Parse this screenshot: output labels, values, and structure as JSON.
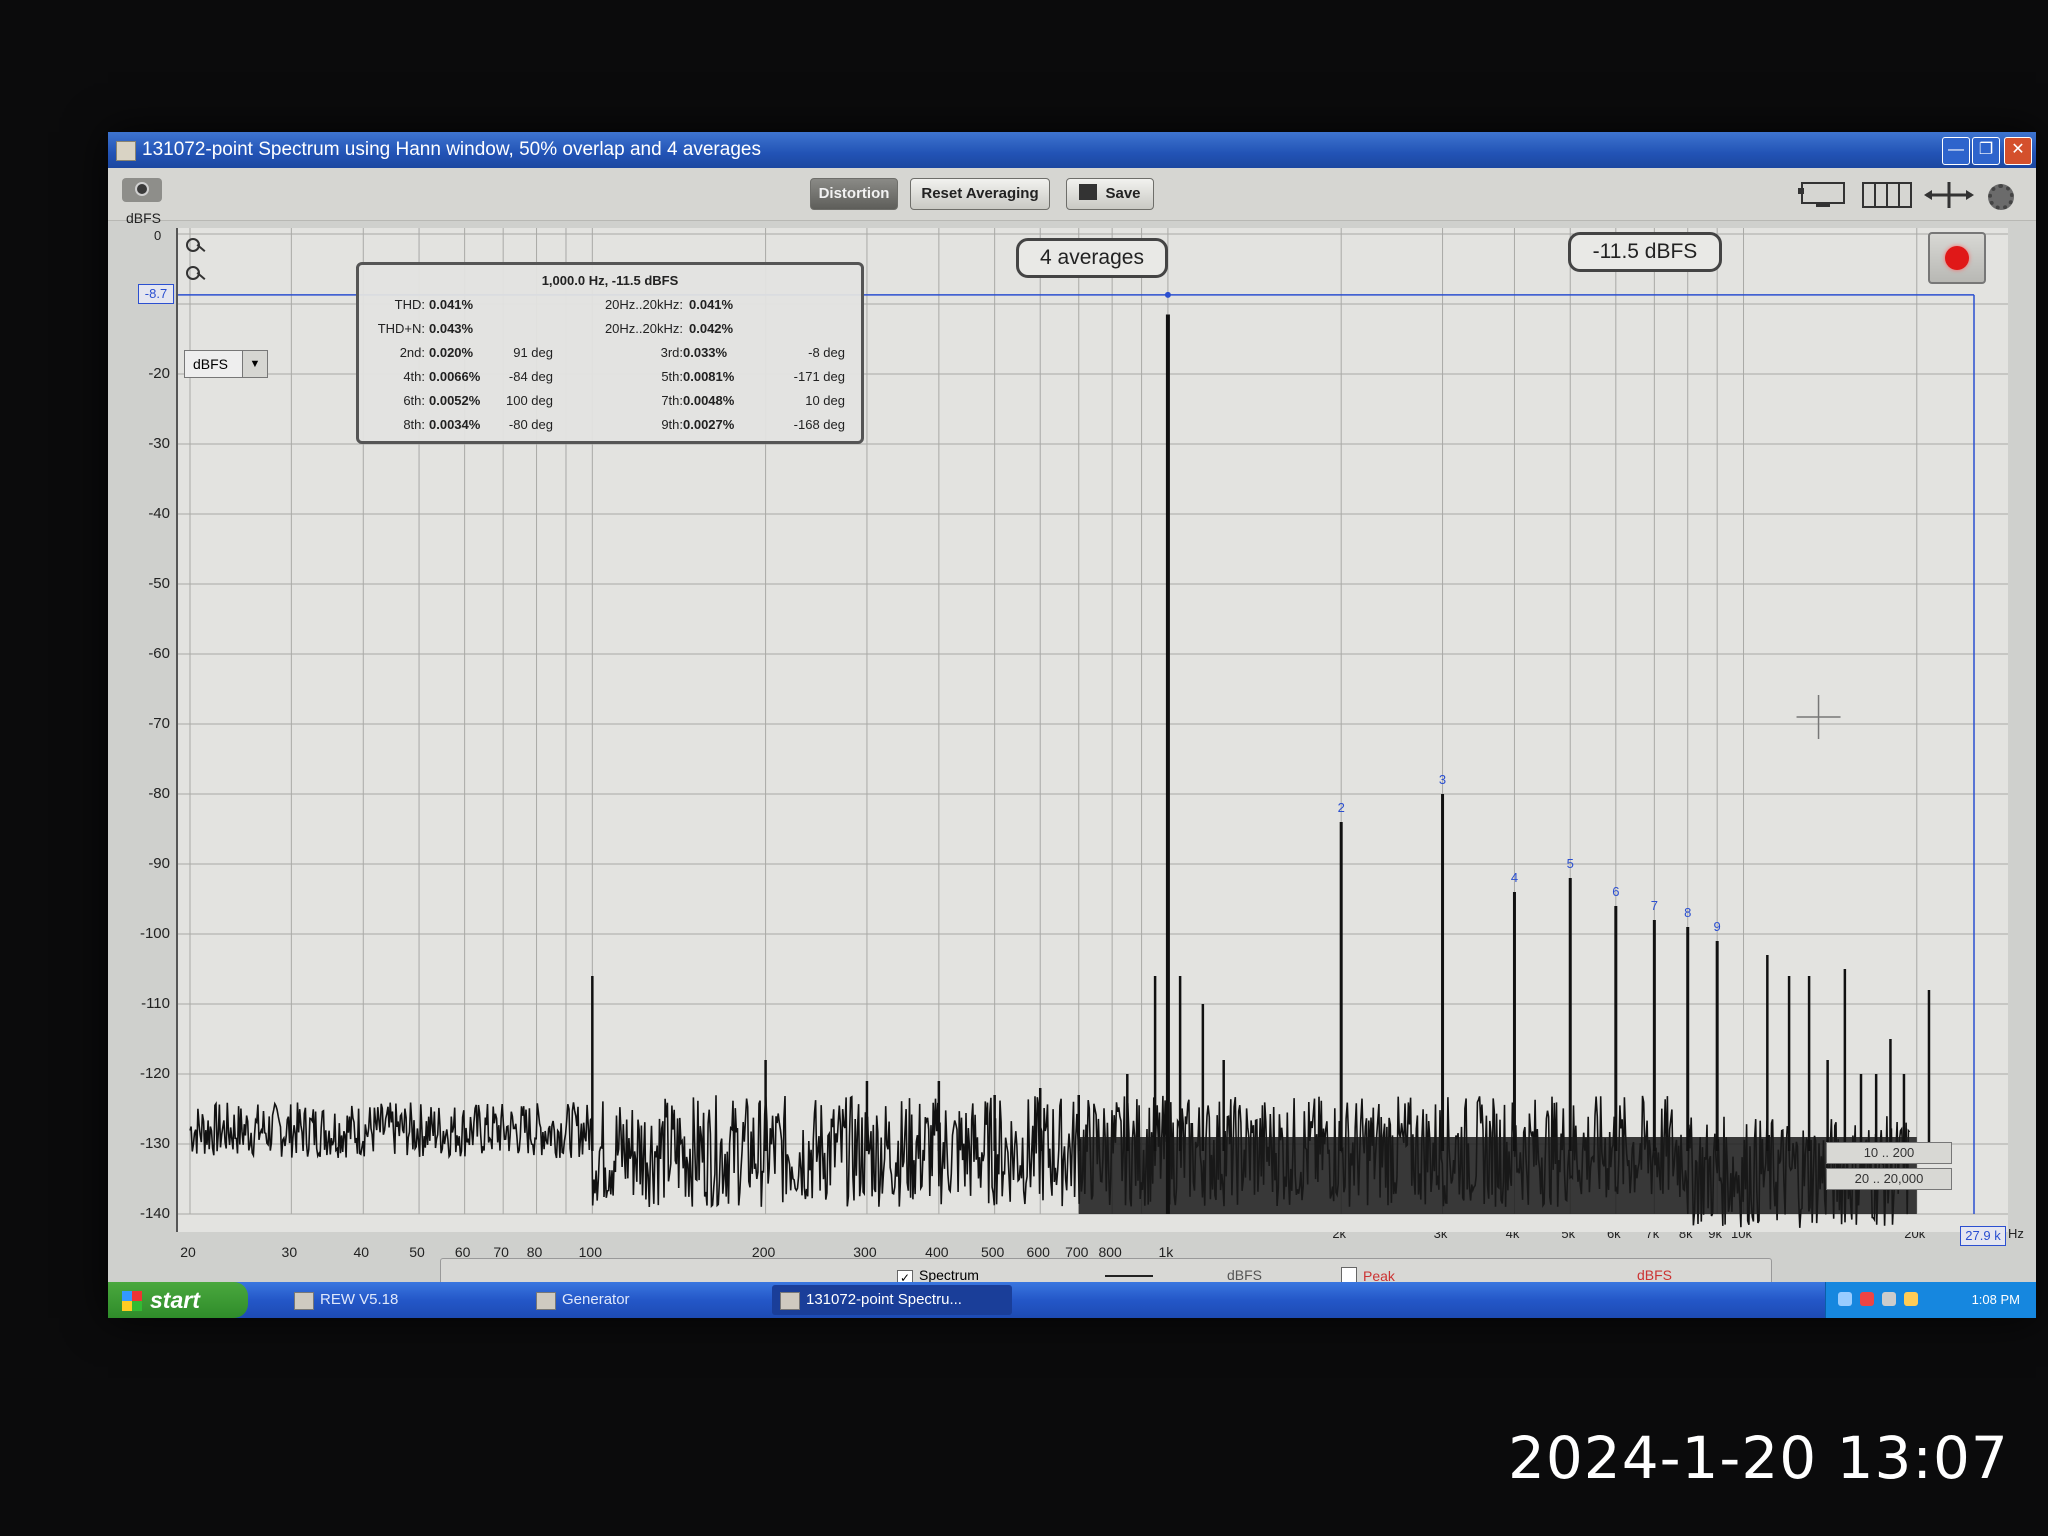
{
  "window": {
    "title": "131072-point Spectrum using Hann window, 50% overlap and 4 averages"
  },
  "toolbar": {
    "distortion_label": "Distortion",
    "reset_label": "Reset Averaging",
    "save_label": "Save"
  },
  "axis": {
    "y_unit": "dBFS",
    "y_zero": "0",
    "y_ticks": [
      "-20",
      "-30",
      "-40",
      "-50",
      "-60",
      "-70",
      "-80",
      "-90",
      "-100",
      "-110",
      "-120",
      "-130",
      "-140"
    ],
    "x_ticks": [
      {
        "label": "20",
        "f": 20
      },
      {
        "label": "30",
        "f": 30
      },
      {
        "label": "40",
        "f": 40
      },
      {
        "label": "50",
        "f": 50
      },
      {
        "label": "60",
        "f": 60
      },
      {
        "label": "70",
        "f": 70
      },
      {
        "label": "80",
        "f": 80
      },
      {
        "label": "100",
        "f": 100
      },
      {
        "label": "200",
        "f": 200
      },
      {
        "label": "300",
        "f": 300
      },
      {
        "label": "400",
        "f": 400
      },
      {
        "label": "500",
        "f": 500
      },
      {
        "label": "600",
        "f": 600
      },
      {
        "label": "700",
        "f": 700
      },
      {
        "label": "800",
        "f": 800
      },
      {
        "label": "1k",
        "f": 1000
      },
      {
        "label": "2k",
        "f": 2000
      },
      {
        "label": "3k",
        "f": 3000
      },
      {
        "label": "4k",
        "f": 4000
      },
      {
        "label": "5k",
        "f": 5000
      },
      {
        "label": "6k",
        "f": 6000
      },
      {
        "label": "7k",
        "f": 7000
      },
      {
        "label": "8k",
        "f": 8000
      },
      {
        "label": "9k",
        "f": 9000
      },
      {
        "label": "10k",
        "f": 10000
      },
      {
        "label": "20k",
        "f": 20000
      }
    ],
    "marker_value": "-8.7",
    "x_edge_value": "27.9 k",
    "x_unit": "Hz"
  },
  "controls": {
    "unit_select": "dBFS"
  },
  "distortion": {
    "header": "1,000.0 Hz, -11.5 dBFS",
    "thd_label": "THD:",
    "thd": "0.041%",
    "thd_band_label": "20Hz..20kHz:",
    "thd_band": "0.041%",
    "thdn_label": "THD+N:",
    "thdn": "0.043%",
    "thdn_band_label": "20Hz..20kHz:",
    "thdn_band": "0.042%",
    "harmonics": [
      {
        "label": "2nd:",
        "pct": "0.020%",
        "phase": "91 deg"
      },
      {
        "label": "3rd:",
        "pct": "0.033%",
        "phase": "-8 deg"
      },
      {
        "label": "4th:",
        "pct": "0.0066%",
        "phase": "-84 deg"
      },
      {
        "label": "5th:",
        "pct": "0.0081%",
        "phase": "-171 deg"
      },
      {
        "label": "6th:",
        "pct": "0.0052%",
        "phase": "100 deg"
      },
      {
        "label": "7th:",
        "pct": "0.0048%",
        "phase": "10 deg"
      },
      {
        "label": "8th:",
        "pct": "0.0034%",
        "phase": "-80 deg"
      },
      {
        "label": "9th:",
        "pct": "0.0027%",
        "phase": "-168 deg"
      }
    ]
  },
  "overlays": {
    "averages": "4 averages",
    "level": "-11.5 dBFS",
    "range_a": "10 .. 200",
    "range_b": "20 .. 20,000"
  },
  "legend": {
    "spectrum": "Spectrum",
    "peak": "Peak",
    "unit": "dBFS",
    "peak_unit": "dBFS"
  },
  "taskbar": {
    "start": "start",
    "tasks": [
      "REW V5.18",
      "Generator",
      "131072-point Spectru..."
    ],
    "clock": "1:08 PM"
  },
  "photo_timestamp": "2024-1-20 13:07",
  "chart_data": {
    "type": "line",
    "xlabel": "Hz",
    "ylabel": "dBFS",
    "x_scale": "log",
    "xlim": [
      20,
      27900
    ],
    "ylim": [
      -140,
      0
    ],
    "grid": true,
    "marker_level_dbfs": -8.7,
    "fundamental": {
      "f": 1000,
      "db": -11.5
    },
    "harmonics": [
      {
        "n": "2",
        "f": 2000,
        "db": -84
      },
      {
        "n": "3",
        "f": 3000,
        "db": -80
      },
      {
        "n": "4",
        "f": 4000,
        "db": -94
      },
      {
        "n": "5",
        "f": 5000,
        "db": -92
      },
      {
        "n": "6",
        "f": 6000,
        "db": -96
      },
      {
        "n": "7",
        "f": 7000,
        "db": -98
      },
      {
        "n": "8",
        "f": 8000,
        "db": -99
      },
      {
        "n": "9",
        "f": 9000,
        "db": -101
      }
    ],
    "spurs": [
      {
        "f": 100,
        "db": -106
      },
      {
        "f": 200,
        "db": -118
      },
      {
        "f": 300,
        "db": -121
      },
      {
        "f": 400,
        "db": -121
      },
      {
        "f": 500,
        "db": -123
      },
      {
        "f": 600,
        "db": -122
      },
      {
        "f": 700,
        "db": -123
      },
      {
        "f": 850,
        "db": -120
      },
      {
        "f": 950,
        "db": -106
      },
      {
        "f": 1050,
        "db": -106
      },
      {
        "f": 1150,
        "db": -110
      },
      {
        "f": 1250,
        "db": -118
      },
      {
        "f": 11000,
        "db": -103
      },
      {
        "f": 12000,
        "db": -106
      },
      {
        "f": 13000,
        "db": -106
      },
      {
        "f": 14000,
        "db": -118
      },
      {
        "f": 15000,
        "db": -105
      },
      {
        "f": 16000,
        "db": -120
      },
      {
        "f": 17000,
        "db": -120
      },
      {
        "f": 18000,
        "db": -115
      },
      {
        "f": 19000,
        "db": -120
      },
      {
        "f": 21000,
        "db": -108
      }
    ],
    "noise_floor_db": -131
  }
}
